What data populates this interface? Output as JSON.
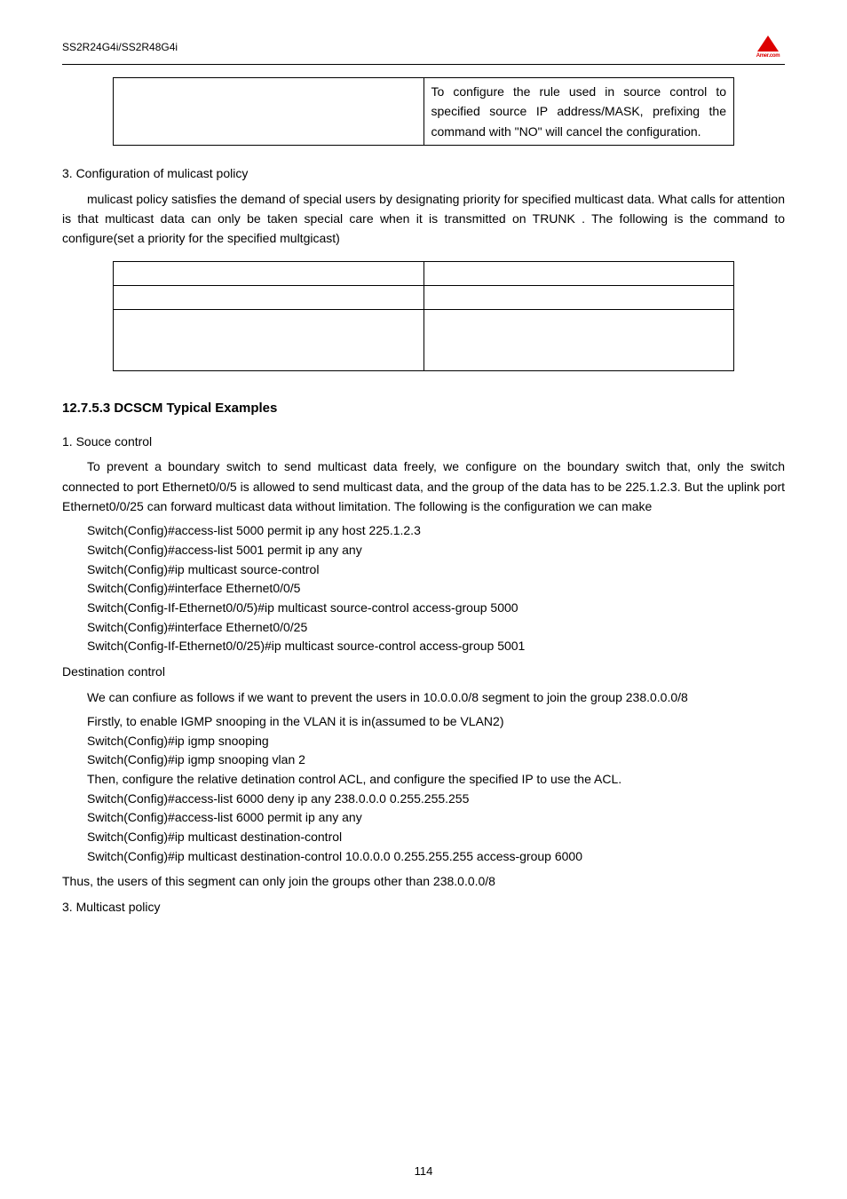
{
  "header": {
    "model": "SS2R24G4i/SS2R48G4i",
    "logo_text": "Amer.com"
  },
  "top_table": {
    "left": "",
    "right": "To configure the rule used in source control to specified source IP address/MASK, prefixing the command with \"NO\" will cancel the configuration."
  },
  "section3_title": "3. Configuration of mulicast policy",
  "section3_body": "mulicast policy satisfies the demand of special users by designating priority for specified multicast data. What calls for attention is that multicast data can only be taken special care when it is transmitted on TRUNK . The following is the command to configure(set a priority for the specified multgicast)",
  "examples_heading": "12.7.5.3 DCSCM Typical Examples",
  "souce_title": "1. Souce control",
  "souce_body": "To prevent a boundary switch to send multicast data freely, we configure on the boundary switch that, only the switch connected to port Ethernet0/0/5 is allowed to send multicast data, and the group of the data has to be 225.1.2.3. But the uplink port Ethernet0/0/25 can forward multicast data without limitation. The following is the configuration we can make",
  "souce_cmds": [
    "Switch(Config)#access-list 5000 permit ip any host 225.1.2.3",
    "Switch(Config)#access-list 5001 permit ip any any",
    "Switch(Config)#ip multicast source-control",
    "Switch(Config)#interface Ethernet0/0/5",
    "Switch(Config-If-Ethernet0/0/5)#ip multicast source-control access-group 5000",
    "Switch(Config)#interface Ethernet0/0/25",
    "Switch(Config-If-Ethernet0/0/25)#ip multicast source-control access-group 5001"
  ],
  "dest_title": "Destination control",
  "dest_intro": "We can confiure as follows if we want to prevent the users in 10.0.0.0/8 segment to join the group  238.0.0.0/8",
  "dest_cmds": [
    "Firstly, to enable IGMP snooping in the VLAN it is in(assumed to be VLAN2)",
    "Switch(Config)#ip igmp snooping",
    "Switch(Config)#ip igmp snooping vlan 2",
    "Then, configure the relative detination control ACL, and configure the specified IP to use the ACL.",
    "Switch(Config)#access-list 6000 deny ip any 238.0.0.0 0.255.255.255",
    "Switch(Config)#access-list 6000 permit ip any any",
    "Switch(Config)#ip multicast destination-control",
    "Switch(Config)#ip multicast destination-control 10.0.0.0 0.255.255.255 access-group 6000"
  ],
  "dest_conclusion": "Thus, the users of this segment can only join the groups other than 238.0.0.0/8",
  "multicast_title": "3.    Multicast policy",
  "page_number": "114"
}
